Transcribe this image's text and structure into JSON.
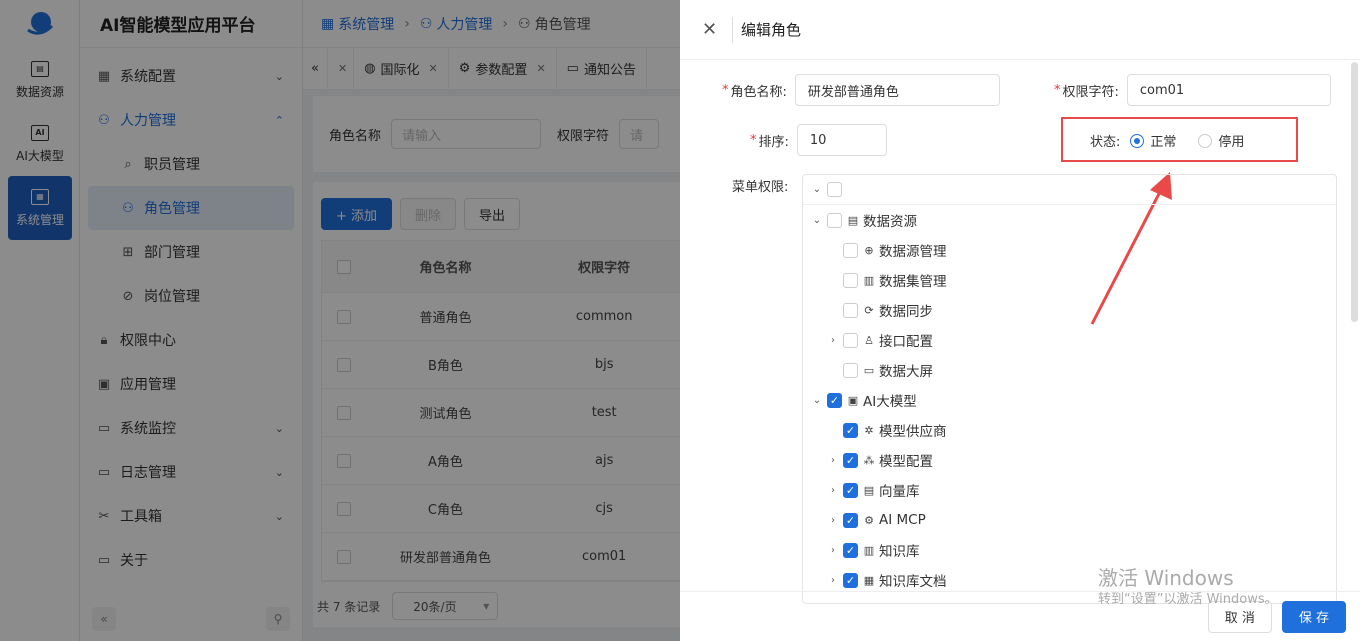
{
  "rail": [
    {
      "label": "数据资源",
      "icon": "data-icon"
    },
    {
      "label": "AI大模型",
      "icon": "ai-icon"
    },
    {
      "label": "系统管理",
      "icon": "system-icon"
    }
  ],
  "brand": "AI智能模型应用平台",
  "sidebar": {
    "items": [
      {
        "label": "系统配置",
        "icon": "grid-icon",
        "chevron": "down"
      },
      {
        "label": "人力管理",
        "icon": "users-icon",
        "chevron": "up",
        "open": true
      },
      {
        "label": "职员管理",
        "icon": "staff-icon",
        "sub": true
      },
      {
        "label": "角色管理",
        "icon": "role-icon",
        "sub": true,
        "active": true
      },
      {
        "label": "部门管理",
        "icon": "dept-icon",
        "sub": true
      },
      {
        "label": "岗位管理",
        "icon": "compass-icon",
        "sub": true
      },
      {
        "label": "权限中心",
        "icon": "lock-icon"
      },
      {
        "label": "应用管理",
        "icon": "app-icon"
      },
      {
        "label": "系统监控",
        "icon": "monitor-icon",
        "chevron": "down"
      },
      {
        "label": "日志管理",
        "icon": "log-icon",
        "chevron": "down"
      },
      {
        "label": "工具箱",
        "icon": "tools-icon",
        "chevron": "down"
      },
      {
        "label": "关于",
        "icon": "about-icon"
      }
    ]
  },
  "breadcrumb": [
    "系统管理",
    "人力管理",
    "角色管理"
  ],
  "tabs": [
    {
      "label": "国际化"
    },
    {
      "label": "参数配置"
    },
    {
      "label": "通知公告"
    }
  ],
  "search": {
    "role_name_label": "角色名称",
    "role_name_placeholder": "请输入",
    "key_label": "权限字符",
    "key_placeholder": "请"
  },
  "toolbar": {
    "add": "+ 添加",
    "delete": "删除",
    "export": "导出"
  },
  "table": {
    "headers": {
      "name": "角色名称",
      "key": "权限字符"
    },
    "rows": [
      {
        "name": "普通角色",
        "key": "common"
      },
      {
        "name": "B角色",
        "key": "bjs"
      },
      {
        "name": "测试角色",
        "key": "test"
      },
      {
        "name": "A角色",
        "key": "ajs"
      },
      {
        "name": "C角色",
        "key": "cjs"
      },
      {
        "name": "研发部普通角色",
        "key": "com01"
      }
    ]
  },
  "pager": {
    "total": "共 7 条记录",
    "size": "20条/页"
  },
  "drawer": {
    "title": "编辑角色",
    "role_name_label": "角色名称:",
    "role_name_value": "研发部普通角色",
    "key_label": "权限字符:",
    "key_value": "com01",
    "sort_label": "排序:",
    "sort_value": "10",
    "status_label": "状态:",
    "status_on": "正常",
    "status_off": "停用",
    "menu_label": "菜单权限:",
    "cancel": "取 消",
    "save": "保 存"
  },
  "tree": [
    {
      "level": 0,
      "toggle": "v",
      "checked": false,
      "label": "",
      "icon": ""
    },
    {
      "level": 0,
      "toggle": "v",
      "checked": false,
      "label": "数据资源",
      "icon": "▤"
    },
    {
      "level": 1,
      "toggle": "",
      "checked": false,
      "label": "数据源管理",
      "icon": "⊕"
    },
    {
      "level": 1,
      "toggle": "",
      "checked": false,
      "label": "数据集管理",
      "icon": "▥"
    },
    {
      "level": 1,
      "toggle": "",
      "checked": false,
      "label": "数据同步",
      "icon": "⟳"
    },
    {
      "level": 1,
      "toggle": ">",
      "checked": false,
      "label": "接口配置",
      "icon": "♙"
    },
    {
      "level": 1,
      "toggle": "",
      "checked": false,
      "label": "数据大屏",
      "icon": "▭"
    },
    {
      "level": 0,
      "toggle": "v",
      "checked": true,
      "label": "AI大模型",
      "icon": "▣"
    },
    {
      "level": 1,
      "toggle": "",
      "checked": true,
      "label": "模型供应商",
      "icon": "✲"
    },
    {
      "level": 1,
      "toggle": ">",
      "checked": true,
      "label": "模型配置",
      "icon": "⁂"
    },
    {
      "level": 1,
      "toggle": ">",
      "checked": true,
      "label": "向量库",
      "icon": "▤"
    },
    {
      "level": 1,
      "toggle": ">",
      "checked": true,
      "label": "AI MCP",
      "icon": "⚙"
    },
    {
      "level": 1,
      "toggle": ">",
      "checked": true,
      "label": "知识库",
      "icon": "▥"
    },
    {
      "level": 1,
      "toggle": ">",
      "checked": true,
      "label": "知识库文档",
      "icon": "▦"
    }
  ],
  "watermark": {
    "line1": "激活 Windows",
    "line2": "转到“设置”以激活 Windows。"
  },
  "colors": {
    "accent": "#1f6fdc",
    "highlight": "#e84a4a"
  }
}
